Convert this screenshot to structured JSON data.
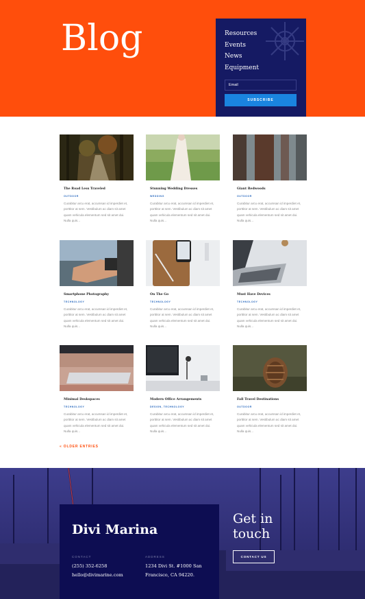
{
  "hero": {
    "title": "Blog",
    "nav": [
      "Resources",
      "Events",
      "News",
      "Equipment"
    ],
    "email_placeholder": "Email",
    "subscribe_label": "SUBSCRIBE",
    "bg_color": "#ff4e0c",
    "panel_color": "#151a63",
    "button_color": "#1a84e0"
  },
  "posts": [
    {
      "title": "The Road Less Traveled",
      "category": "OUTDOOR",
      "excerpt": "Curabitur arcu erat, accumsan id imperdiet et, porttitor at sem. Vestibulum ac diam sit amet quam vehicula elementum sed sit amet dui. Nulla quis...",
      "image": "forest-road"
    },
    {
      "title": "Stunning Wedding Dresses",
      "category": "WEDDING",
      "excerpt": "Curabitur arcu erat, accumsan id imperdiet et, porttitor at sem. Vestibulum ac diam sit amet quam vehicula elementum sed sit amet dui. Nulla quis...",
      "image": "wedding-dress"
    },
    {
      "title": "Giant Redwoods",
      "category": "OUTDOOR",
      "excerpt": "Curabitur arcu erat, accumsan id imperdiet et, porttitor at sem. Vestibulum ac diam sit amet quam vehicula elementum sed sit amet dui. Nulla quis...",
      "image": "redwoods"
    },
    {
      "title": "Smartphone Photography",
      "category": "TECHNOLOGY",
      "excerpt": "Curabitur arcu erat, accumsan id imperdiet et, porttitor at sem. Vestibulum ac diam sit amet quam vehicula elementum sed sit amet dui. Nulla quis...",
      "image": "smartphone-photo"
    },
    {
      "title": "On The Go",
      "category": "TECHNOLOGY",
      "excerpt": "Curabitur arcu erat, accumsan id imperdiet et, porttitor at sem. Vestibulum ac diam sit amet quam vehicula elementum sed sit amet dui. Nulla quis...",
      "image": "phone-notebook"
    },
    {
      "title": "Must Have Devices",
      "category": "TECHNOLOGY",
      "excerpt": "Curabitur arcu erat, accumsan id imperdiet et, porttitor at sem. Vestibulum ac diam sit amet quam vehicula elementum sed sit amet dui. Nulla quis...",
      "image": "laptop"
    },
    {
      "title": "Minimal Deskspaces",
      "category": "TECHNOLOGY",
      "excerpt": "Curabitur arcu erat, accumsan id imperdiet et, porttitor at sem. Vestibulum ac diam sit amet quam vehicula elementum sed sit amet dui. Nulla quis...",
      "image": "keyboard"
    },
    {
      "title": "Modern Office Arrangements",
      "category": "DESIGN, TECHNOLOGY",
      "excerpt": "Curabitur arcu erat, accumsan id imperdiet et, porttitor at sem. Vestibulum ac diam sit amet quam vehicula elementum sed sit amet dui. Nulla quis...",
      "image": "office-desk"
    },
    {
      "title": "Fall Travel Destinations",
      "category": "OUTDOOR",
      "excerpt": "Curabitur arcu erat, accumsan id imperdiet et, porttitor at sem. Vestibulum ac diam sit amet quam vehicula elementum sed sit amet dui. Nulla quis...",
      "image": "pinecone"
    }
  ],
  "older_entries": "« OLDER ENTRIES",
  "footer": {
    "brand": "Divi Marina",
    "contact_label": "CONTACT",
    "phone": "(255) 352-6258",
    "email": "hello@divimarine.com",
    "address_label": "ADDRESS",
    "address_line1": "1234 Divi St. #1000 San",
    "address_line2": "Francisco, CA 94220.",
    "touch_line1": "Get in",
    "touch_line2": "touch",
    "contact_button": "CONTACT US",
    "box_color": "#0d0d52"
  }
}
